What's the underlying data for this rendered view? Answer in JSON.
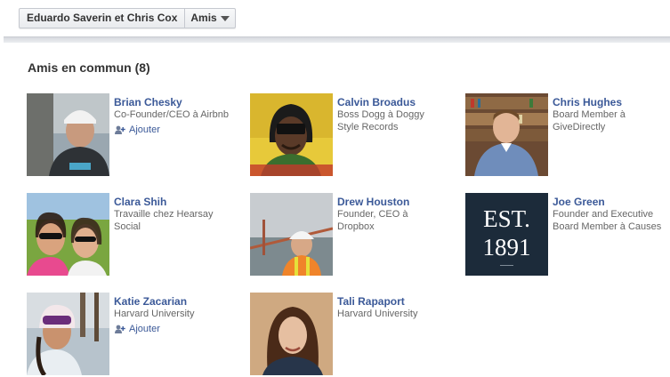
{
  "toolbar": {
    "names": "Eduardo Saverin et Chris Cox",
    "relationship": "Amis"
  },
  "section": {
    "title": "Amis en commun (8)"
  },
  "friends": [
    {
      "name": "Brian Chesky",
      "line1": "Co-Founder/CEO à Airbnb",
      "line2": "",
      "action": "Ajouter"
    },
    {
      "name": "Calvin Broadus",
      "line1": "Boss Dogg à Doggy",
      "line2": "Style Records",
      "action": ""
    },
    {
      "name": "Chris Hughes",
      "line1": "Board Member à",
      "line2": "GiveDirectly",
      "action": ""
    },
    {
      "name": "Clara Shih",
      "line1": "Travaille chez Hearsay",
      "line2": "Social",
      "action": ""
    },
    {
      "name": "Drew Houston",
      "line1": "Founder, CEO à",
      "line2": "Dropbox",
      "action": ""
    },
    {
      "name": "Joe Green",
      "line1": "Founder and Executive",
      "line2": "Board Member à Causes",
      "action": ""
    },
    {
      "name": "Katie Zacarian",
      "line1": "Harvard University",
      "line2": "",
      "action": "Ajouter"
    },
    {
      "name": "Tali Rapaport",
      "line1": "Harvard University",
      "line2": "",
      "action": ""
    }
  ],
  "logo_text": {
    "line1": "EST.",
    "line2": "1891"
  },
  "colors": {
    "link": "#3b5998",
    "muted": "#666666"
  },
  "icons": {
    "add": "add-friend-icon",
    "dropdown": "chevron-down-icon"
  }
}
